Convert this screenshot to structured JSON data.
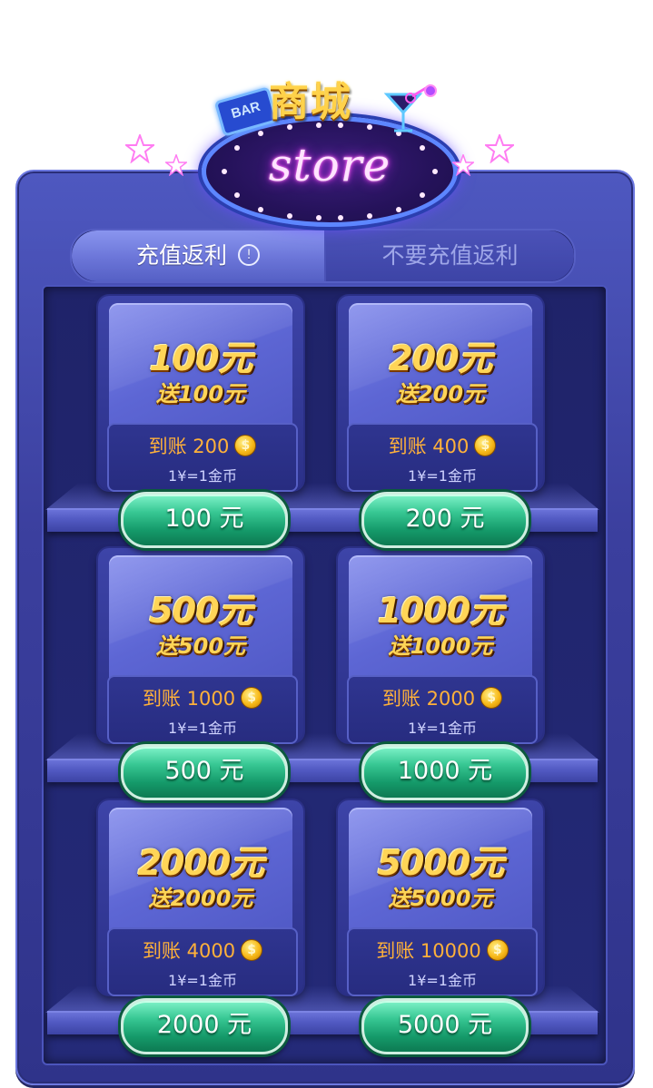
{
  "header": {
    "title_cn": "商城",
    "sign_text": "store",
    "bar_sign": "BAR"
  },
  "tabs": [
    {
      "label": "充值返利",
      "active": true
    },
    {
      "label": "不要充值返利",
      "active": false
    }
  ],
  "products": [
    {
      "amount": "100元",
      "bonus": "送100元",
      "arrive": "到账 200",
      "rate": "1¥=1金币",
      "button": "100 元"
    },
    {
      "amount": "200元",
      "bonus": "送200元",
      "arrive": "到账 400",
      "rate": "1¥=1金币",
      "button": "200 元"
    },
    {
      "amount": "500元",
      "bonus": "送500元",
      "arrive": "到账 1000",
      "rate": "1¥=1金币",
      "button": "500 元"
    },
    {
      "amount": "1000元",
      "bonus": "送1000元",
      "arrive": "到账 2000",
      "rate": "1¥=1金币",
      "button": "1000 元"
    },
    {
      "amount": "2000元",
      "bonus": "送2000元",
      "arrive": "到账 4000",
      "rate": "1¥=1金币",
      "button": "2000 元"
    },
    {
      "amount": "5000元",
      "bonus": "送5000元",
      "arrive": "到账 10000",
      "rate": "1¥=1金币",
      "button": "5000 元"
    }
  ],
  "icons": {
    "info": "info-icon",
    "coin": "gold-coin-icon",
    "cocktail": "cocktail-glass-icon",
    "star": "star-icon"
  },
  "colors": {
    "frame": "#3b3f9e",
    "gold_text": "#ffd557",
    "arrive_text": "#ffb13a",
    "buy_button": "#37c793",
    "neon": "#ff4bf0"
  }
}
